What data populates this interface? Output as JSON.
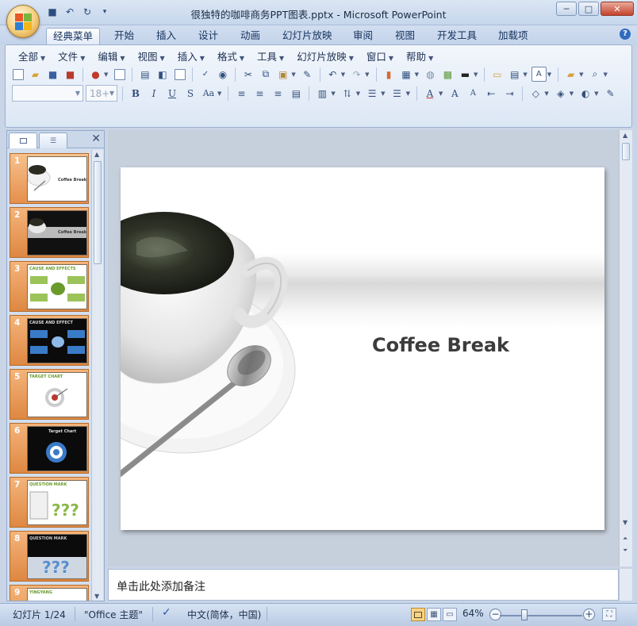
{
  "window": {
    "title": "很独特的咖啡商务PPT图表.pptx - Microsoft PowerPoint"
  },
  "quick_access": {
    "save": "💾",
    "undo": "↶",
    "redo": "↻",
    "customize": "▾"
  },
  "ribbon_tabs": [
    {
      "label": "经典菜单",
      "active": true
    },
    {
      "label": "开始"
    },
    {
      "label": "插入"
    },
    {
      "label": "设计"
    },
    {
      "label": "动画"
    },
    {
      "label": "幻灯片放映"
    },
    {
      "label": "审阅"
    },
    {
      "label": "视图"
    },
    {
      "label": "开发工具"
    },
    {
      "label": "加载项"
    }
  ],
  "classic_menus": [
    "全部",
    "文件",
    "编辑",
    "视图",
    "插入",
    "格式",
    "工具",
    "幻灯片放映",
    "窗口",
    "帮助"
  ],
  "format_bar": {
    "font_name": "",
    "font_size": "18+"
  },
  "slide_panel": {
    "thumbs": [
      {
        "num": "1",
        "label": "Coffee Break"
      },
      {
        "num": "2",
        "label": "Coffee Break"
      },
      {
        "num": "3",
        "label": "CAUSE AND EFFECTS"
      },
      {
        "num": "4",
        "label": "CAUSE AND EFFECT"
      },
      {
        "num": "5",
        "label": "TARGET CHART"
      },
      {
        "num": "6",
        "label": "Target Chart"
      },
      {
        "num": "7",
        "label": "QUESTION MARK"
      },
      {
        "num": "8",
        "label": "QUESTION MARK"
      },
      {
        "num": "9",
        "label": "YINGYANG"
      }
    ]
  },
  "slide": {
    "title": "Coffee Break"
  },
  "notes": {
    "placeholder": "单击此处添加备注"
  },
  "status": {
    "slide_info": "幻灯片 1/24",
    "theme": "\"Office 主题\"",
    "language": "中文(简体，中国)",
    "zoom": "64%",
    "zoom_fraction": 0.3
  }
}
